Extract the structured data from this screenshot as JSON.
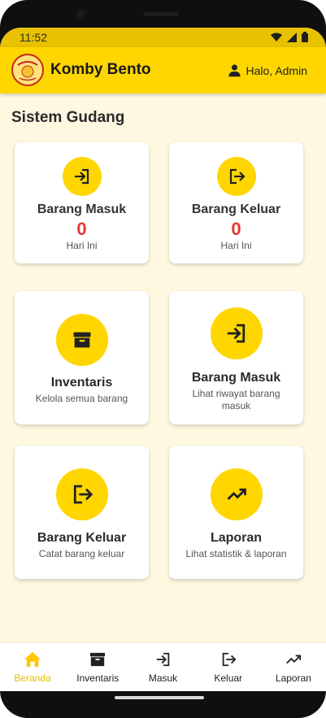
{
  "status_bar": {
    "time": "11:52"
  },
  "app_bar": {
    "title": "Komby Bento",
    "greeting": "Halo, Admin",
    "logo_text": "Komby Bento"
  },
  "section_title": "Sistem Gudang",
  "stats": [
    {
      "label": "Barang Masuk",
      "value": "0",
      "sub": "Hari Ini",
      "icon": "login-icon"
    },
    {
      "label": "Barang Keluar",
      "value": "0",
      "sub": "Hari Ini",
      "icon": "logout-icon"
    }
  ],
  "menu": [
    {
      "label": "Inventaris",
      "sub": "Kelola semua barang",
      "icon": "archive-icon"
    },
    {
      "label": "Barang Masuk",
      "sub": "Lihat riwayat barang masuk",
      "icon": "login-icon"
    },
    {
      "label": "Barang Keluar",
      "sub": "Catat barang keluar",
      "icon": "logout-icon"
    },
    {
      "label": "Laporan",
      "sub": "Lihat statistik & laporan",
      "icon": "trending-up-icon"
    }
  ],
  "bottom_nav": [
    {
      "label": "Beranda",
      "icon": "home-icon",
      "active": true
    },
    {
      "label": "Inventaris",
      "icon": "archive-icon"
    },
    {
      "label": "Masuk",
      "icon": "login-icon"
    },
    {
      "label": "Keluar",
      "icon": "logout-icon"
    },
    {
      "label": "Laporan",
      "icon": "trending-up-icon"
    }
  ],
  "colors": {
    "primary": "#ffd600",
    "background": "#fff8e1",
    "accent_value": "#e53935",
    "active_nav": "#e7c000"
  }
}
